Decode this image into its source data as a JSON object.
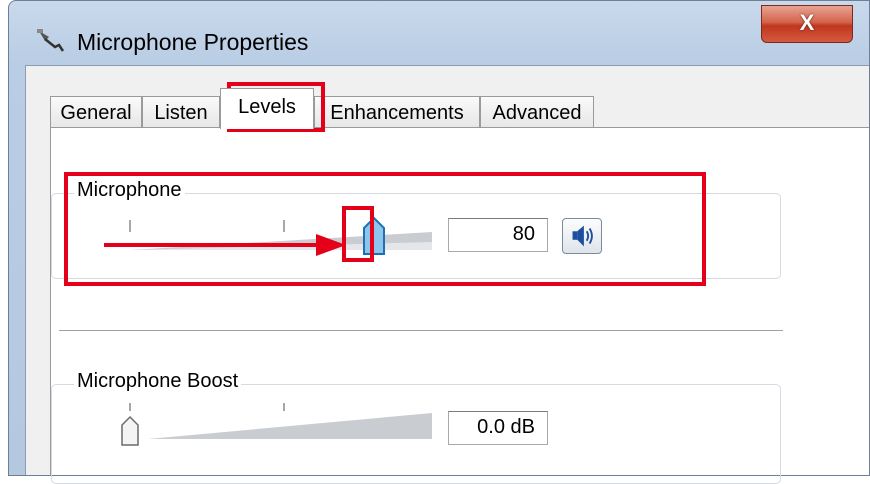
{
  "window": {
    "title": "Microphone Properties",
    "close_label": "X"
  },
  "tabs": [
    {
      "label": "General"
    },
    {
      "label": "Listen"
    },
    {
      "label": "Levels"
    },
    {
      "label": "Enhancements"
    },
    {
      "label": "Advanced"
    }
  ],
  "active_tab": "Levels",
  "microphone": {
    "label": "Microphone",
    "value": "80",
    "level": 0.8,
    "icon": "speaker-icon"
  },
  "boost": {
    "label": "Microphone Boost",
    "value": "0.0 dB",
    "level": 0.0
  },
  "annotation_color": "#e5001a"
}
